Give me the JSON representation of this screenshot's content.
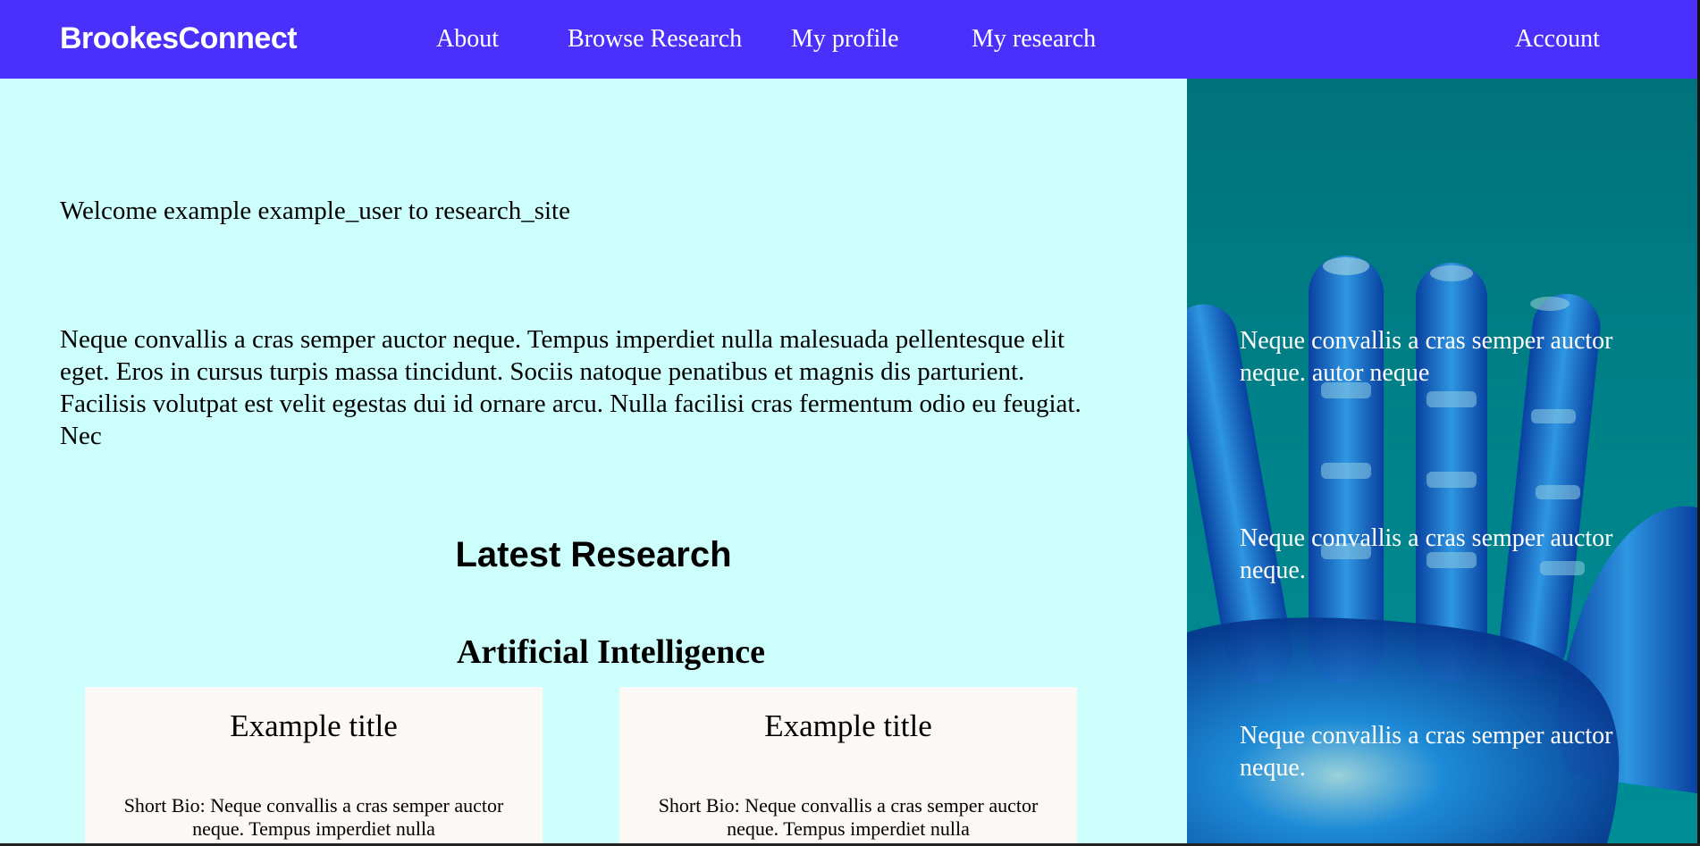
{
  "navbar": {
    "brand": "BrookesConnect",
    "links": {
      "about": "About",
      "browse": "Browse Research",
      "profile": "My profile",
      "research": "My research",
      "account": "Account"
    },
    "background_color": "#4b2ffb"
  },
  "main": {
    "welcome": "Welcome example example_user to research_site",
    "intro": "Neque convallis a cras semper auctor neque. Tempus imperdiet nulla malesuada pellentesque elit eget. Eros in cursus turpis massa tincidunt. Sociis natoque penatibus et magnis dis parturient. Facilisis volutpat est velit egestas dui id ornare arcu. Nulla facilisi cras fermentum odio eu feugiat. Nec",
    "section_heading": "Latest Research",
    "topic_heading": "Artificial Intelligence",
    "cards": [
      {
        "title": "Example title",
        "bio": "Short Bio: Neque convallis a cras semper auctor neque. Tempus imperdiet nulla"
      },
      {
        "title": "Example title",
        "bio": "Short Bio: Neque convallis a cras semper auctor neque. Tempus imperdiet nulla"
      }
    ],
    "background_color": "#ccfffc"
  },
  "side": {
    "image_icon": "robot-hand-image",
    "texts": [
      "Neque convallis a cras semper auctor neque. autor neque",
      "Neque convallis a cras semper auctor neque.",
      "Neque convallis a cras semper auctor neque."
    ],
    "background_color": "#00838a"
  }
}
